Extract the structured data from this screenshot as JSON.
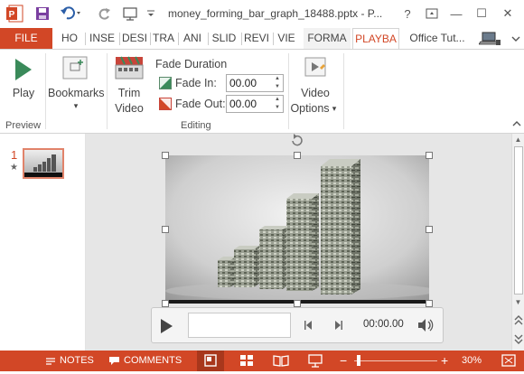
{
  "window": {
    "title": "money_forming_bar_graph_18488.pptx - P...",
    "help": "?",
    "restore": "⧉",
    "minimize": "—",
    "maximize": "☐",
    "close": "✕"
  },
  "tabs": [
    {
      "label": "FILE"
    },
    {
      "label": "HO"
    },
    {
      "label": "INSE"
    },
    {
      "label": "DESI"
    },
    {
      "label": "TRA"
    },
    {
      "label": "ANI"
    },
    {
      "label": "SLID"
    },
    {
      "label": "REVI"
    },
    {
      "label": "VIE"
    },
    {
      "label": "FORMA"
    },
    {
      "label": "PLAYBA"
    },
    {
      "label": "Office Tut..."
    }
  ],
  "ribbon": {
    "preview": {
      "group": "Preview",
      "play": "Play"
    },
    "bookmarks": {
      "label": "Bookmarks",
      "arrow": "▾"
    },
    "editing": {
      "group": "Editing",
      "trim_line1": "Trim",
      "trim_line2": "Video",
      "fade_duration": "Fade Duration",
      "fade_in_label": "Fade In:",
      "fade_in_value": "00.00",
      "fade_out_label": "Fade Out:",
      "fade_out_value": "00.00"
    },
    "video_options": {
      "line1": "Video",
      "line2": "Options",
      "arrow": "▾"
    }
  },
  "thumbnails": [
    {
      "number": "1",
      "star": "★"
    }
  ],
  "player": {
    "time": "00:00.00"
  },
  "statusbar": {
    "notes": "NOTES",
    "comments": "COMMENTS",
    "zoom": "30%",
    "minus": "−",
    "plus": "+"
  },
  "colors": {
    "accent": "#d24726",
    "play_green": "#3a8a5a"
  }
}
